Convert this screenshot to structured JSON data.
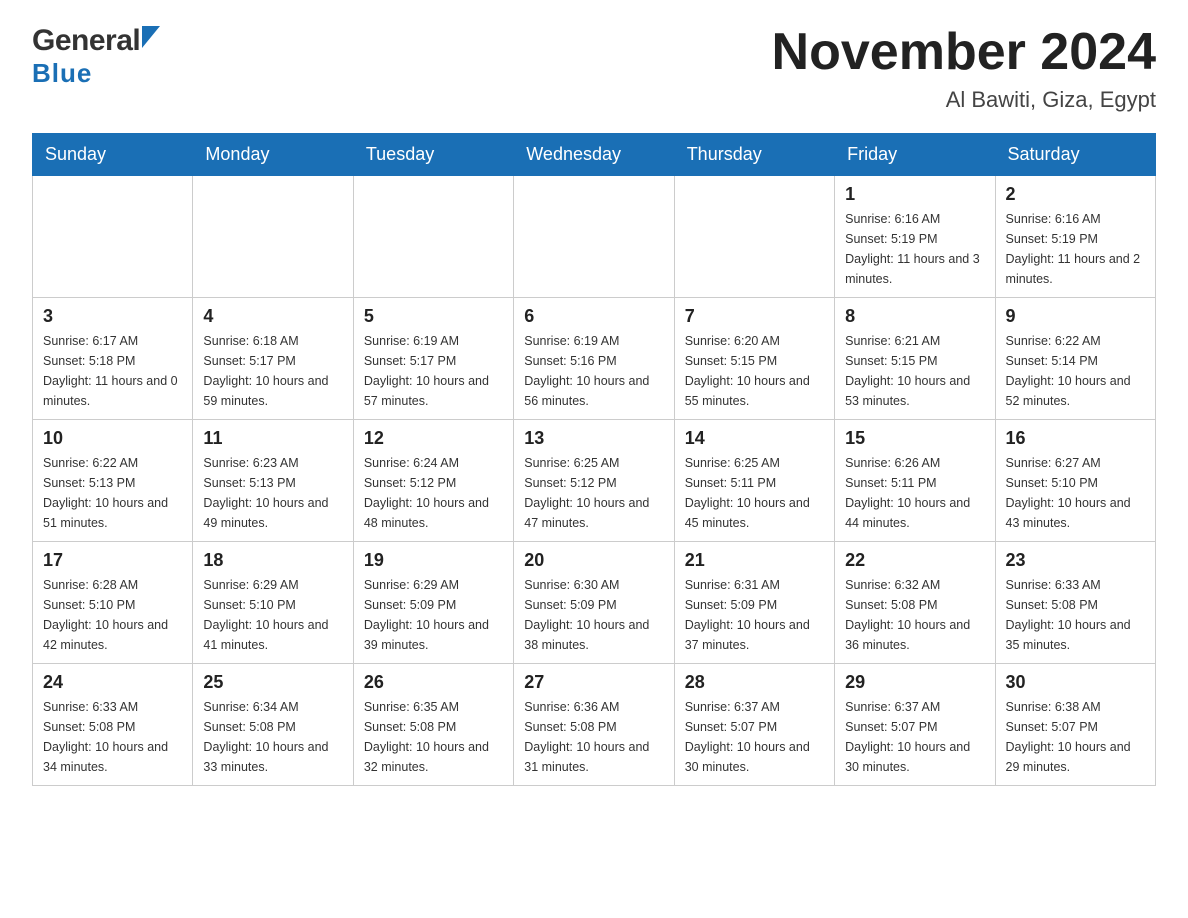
{
  "header": {
    "logo_general": "General",
    "logo_blue": "Blue",
    "title": "November 2024",
    "location": "Al Bawiti, Giza, Egypt"
  },
  "days_of_week": [
    "Sunday",
    "Monday",
    "Tuesday",
    "Wednesday",
    "Thursday",
    "Friday",
    "Saturday"
  ],
  "weeks": [
    [
      {
        "day": "",
        "info": ""
      },
      {
        "day": "",
        "info": ""
      },
      {
        "day": "",
        "info": ""
      },
      {
        "day": "",
        "info": ""
      },
      {
        "day": "",
        "info": ""
      },
      {
        "day": "1",
        "info": "Sunrise: 6:16 AM\nSunset: 5:19 PM\nDaylight: 11 hours and 3 minutes."
      },
      {
        "day": "2",
        "info": "Sunrise: 6:16 AM\nSunset: 5:19 PM\nDaylight: 11 hours and 2 minutes."
      }
    ],
    [
      {
        "day": "3",
        "info": "Sunrise: 6:17 AM\nSunset: 5:18 PM\nDaylight: 11 hours and 0 minutes."
      },
      {
        "day": "4",
        "info": "Sunrise: 6:18 AM\nSunset: 5:17 PM\nDaylight: 10 hours and 59 minutes."
      },
      {
        "day": "5",
        "info": "Sunrise: 6:19 AM\nSunset: 5:17 PM\nDaylight: 10 hours and 57 minutes."
      },
      {
        "day": "6",
        "info": "Sunrise: 6:19 AM\nSunset: 5:16 PM\nDaylight: 10 hours and 56 minutes."
      },
      {
        "day": "7",
        "info": "Sunrise: 6:20 AM\nSunset: 5:15 PM\nDaylight: 10 hours and 55 minutes."
      },
      {
        "day": "8",
        "info": "Sunrise: 6:21 AM\nSunset: 5:15 PM\nDaylight: 10 hours and 53 minutes."
      },
      {
        "day": "9",
        "info": "Sunrise: 6:22 AM\nSunset: 5:14 PM\nDaylight: 10 hours and 52 minutes."
      }
    ],
    [
      {
        "day": "10",
        "info": "Sunrise: 6:22 AM\nSunset: 5:13 PM\nDaylight: 10 hours and 51 minutes."
      },
      {
        "day": "11",
        "info": "Sunrise: 6:23 AM\nSunset: 5:13 PM\nDaylight: 10 hours and 49 minutes."
      },
      {
        "day": "12",
        "info": "Sunrise: 6:24 AM\nSunset: 5:12 PM\nDaylight: 10 hours and 48 minutes."
      },
      {
        "day": "13",
        "info": "Sunrise: 6:25 AM\nSunset: 5:12 PM\nDaylight: 10 hours and 47 minutes."
      },
      {
        "day": "14",
        "info": "Sunrise: 6:25 AM\nSunset: 5:11 PM\nDaylight: 10 hours and 45 minutes."
      },
      {
        "day": "15",
        "info": "Sunrise: 6:26 AM\nSunset: 5:11 PM\nDaylight: 10 hours and 44 minutes."
      },
      {
        "day": "16",
        "info": "Sunrise: 6:27 AM\nSunset: 5:10 PM\nDaylight: 10 hours and 43 minutes."
      }
    ],
    [
      {
        "day": "17",
        "info": "Sunrise: 6:28 AM\nSunset: 5:10 PM\nDaylight: 10 hours and 42 minutes."
      },
      {
        "day": "18",
        "info": "Sunrise: 6:29 AM\nSunset: 5:10 PM\nDaylight: 10 hours and 41 minutes."
      },
      {
        "day": "19",
        "info": "Sunrise: 6:29 AM\nSunset: 5:09 PM\nDaylight: 10 hours and 39 minutes."
      },
      {
        "day": "20",
        "info": "Sunrise: 6:30 AM\nSunset: 5:09 PM\nDaylight: 10 hours and 38 minutes."
      },
      {
        "day": "21",
        "info": "Sunrise: 6:31 AM\nSunset: 5:09 PM\nDaylight: 10 hours and 37 minutes."
      },
      {
        "day": "22",
        "info": "Sunrise: 6:32 AM\nSunset: 5:08 PM\nDaylight: 10 hours and 36 minutes."
      },
      {
        "day": "23",
        "info": "Sunrise: 6:33 AM\nSunset: 5:08 PM\nDaylight: 10 hours and 35 minutes."
      }
    ],
    [
      {
        "day": "24",
        "info": "Sunrise: 6:33 AM\nSunset: 5:08 PM\nDaylight: 10 hours and 34 minutes."
      },
      {
        "day": "25",
        "info": "Sunrise: 6:34 AM\nSunset: 5:08 PM\nDaylight: 10 hours and 33 minutes."
      },
      {
        "day": "26",
        "info": "Sunrise: 6:35 AM\nSunset: 5:08 PM\nDaylight: 10 hours and 32 minutes."
      },
      {
        "day": "27",
        "info": "Sunrise: 6:36 AM\nSunset: 5:08 PM\nDaylight: 10 hours and 31 minutes."
      },
      {
        "day": "28",
        "info": "Sunrise: 6:37 AM\nSunset: 5:07 PM\nDaylight: 10 hours and 30 minutes."
      },
      {
        "day": "29",
        "info": "Sunrise: 6:37 AM\nSunset: 5:07 PM\nDaylight: 10 hours and 30 minutes."
      },
      {
        "day": "30",
        "info": "Sunrise: 6:38 AM\nSunset: 5:07 PM\nDaylight: 10 hours and 29 minutes."
      }
    ]
  ]
}
